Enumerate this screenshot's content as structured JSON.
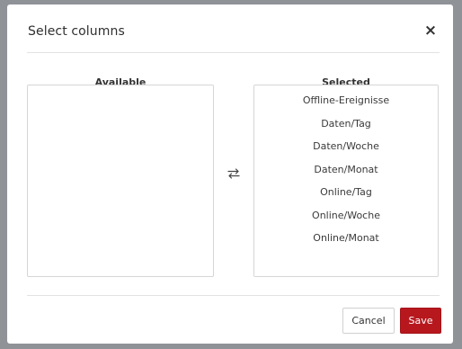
{
  "dialog": {
    "title": "Select columns",
    "close_label": "×"
  },
  "available": {
    "header": "Available",
    "items": []
  },
  "selected": {
    "header": "Selected",
    "items": [
      "Offline-Ereignisse",
      "Daten/Tag",
      "Daten/Woche",
      "Daten/Monat",
      "Online/Tag",
      "Online/Woche",
      "Online/Monat"
    ]
  },
  "icons": {
    "transfer": "swap-arrows-icon",
    "close": "close-icon"
  },
  "footer": {
    "cancel_label": "Cancel",
    "save_label": "Save"
  },
  "colors": {
    "backdrop": "#8f9398",
    "primary": "#b7181e"
  }
}
